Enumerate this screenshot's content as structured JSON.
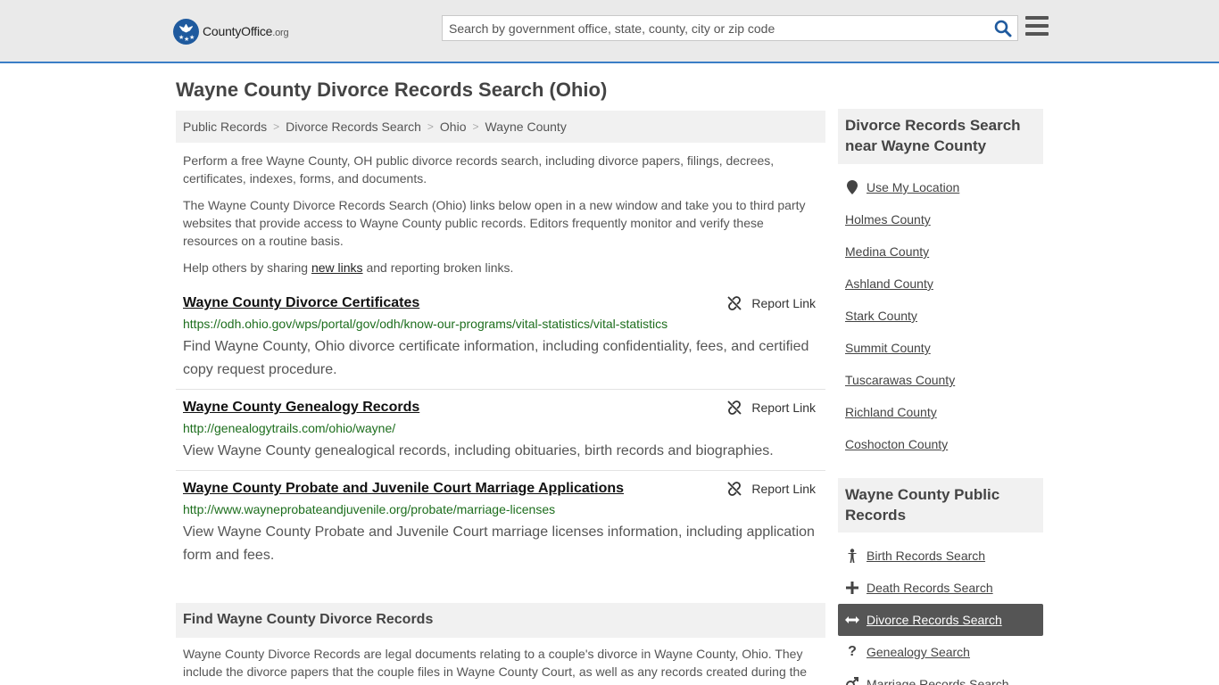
{
  "header": {
    "logo_main": "CountyOffice",
    "logo_tld": ".org",
    "search_placeholder": "Search by government office, state, county, city or zip code"
  },
  "page": {
    "title": "Wayne County Divorce Records Search (Ohio)"
  },
  "breadcrumb": [
    "Public Records",
    "Divorce Records Search",
    "Ohio",
    "Wayne County"
  ],
  "intro": {
    "p1": "Perform a free Wayne County, OH public divorce records search, including divorce papers, filings, decrees, certificates, indexes, forms, and documents.",
    "p2": "The Wayne County Divorce Records Search (Ohio) links below open in a new window and take you to third party websites that provide access to Wayne County public records. Editors frequently monitor and verify these resources on a routine basis.",
    "p3_before": "Help others by sharing ",
    "p3_link": "new links",
    "p3_after": " and reporting broken links."
  },
  "results": [
    {
      "title": "Wayne County Divorce Certificates",
      "url": "https://odh.ohio.gov/wps/portal/gov/odh/know-our-programs/vital-statistics/vital-statistics",
      "description": "Find Wayne County, Ohio divorce certificate information, including confidentiality, fees, and certified copy request procedure.",
      "report_label": "Report Link"
    },
    {
      "title": "Wayne County Genealogy Records",
      "url": "http://genealogytrails.com/ohio/wayne/",
      "description": "View Wayne County genealogical records, including obituaries, birth records and biographies.",
      "report_label": "Report Link"
    },
    {
      "title": "Wayne County Probate and Juvenile Court Marriage Applications",
      "url": "http://www.wayneprobateandjuvenile.org/probate/marriage-licenses",
      "description": "View Wayne County Probate and Juvenile Court marriage licenses information, including application form and fees.",
      "report_label": "Report Link"
    }
  ],
  "find_section": {
    "heading": "Find Wayne County Divorce Records",
    "text": "Wayne County Divorce Records are legal documents relating to a couple's divorce in Wayne County, Ohio. They include the divorce papers that the couple files in Wayne County Court, as well as any records created during the"
  },
  "sidebar": {
    "nearby_heading": "Divorce Records Search near Wayne County",
    "use_location": "Use My Location",
    "nearby": [
      "Holmes County",
      "Medina County",
      "Ashland County",
      "Stark County",
      "Summit County",
      "Tuscarawas County",
      "Richland County",
      "Coshocton County"
    ],
    "public_heading": "Wayne County Public Records",
    "public_records": [
      {
        "label": "Birth Records Search",
        "icon": "person-icon"
      },
      {
        "label": "Death Records Search",
        "icon": "plus-icon"
      },
      {
        "label": "Divorce Records Search",
        "icon": "arrows-horizontal-icon",
        "active": true
      },
      {
        "label": "Genealogy Search",
        "icon": "question-icon"
      },
      {
        "label": "Marriage Records Search",
        "icon": "gender-icon"
      }
    ]
  },
  "colors": {
    "accent_border": "#3a7ec6",
    "logo_blue": "#1f5a9e",
    "url_green": "#1d6e1d",
    "active_bg": "#555555"
  }
}
